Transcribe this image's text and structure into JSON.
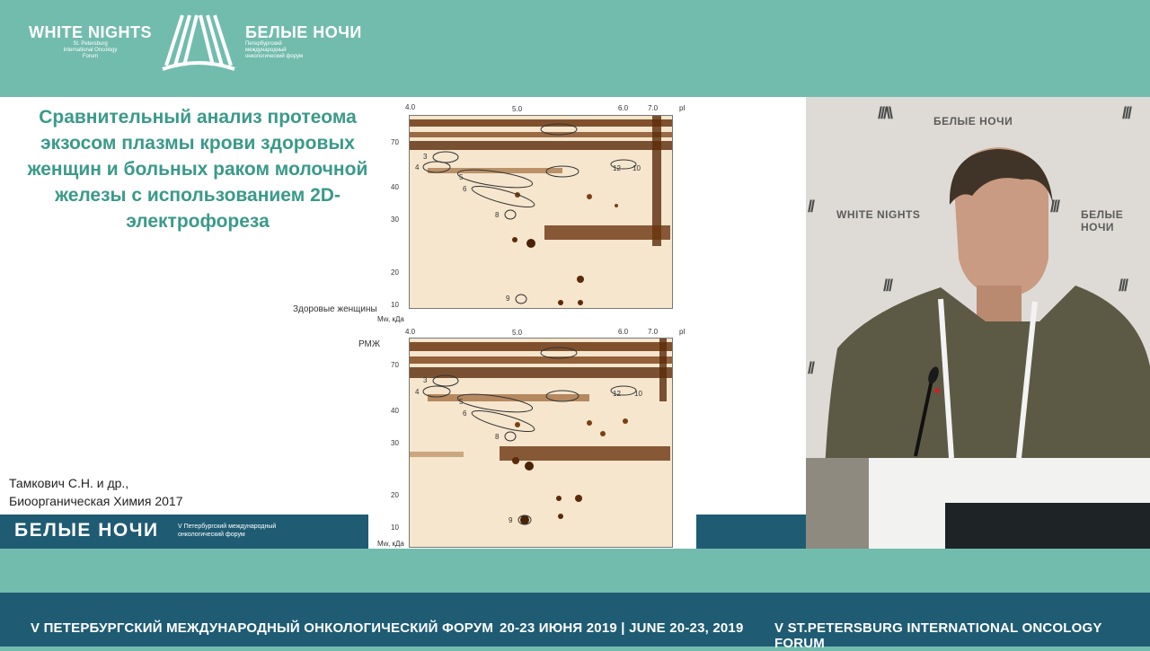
{
  "header": {
    "logo_en_title": "WHITE NIGHTS",
    "logo_en_sub": "St. Petersburg International Oncology Forum",
    "logo_ru_title": "БЕЛЫЕ НОЧИ",
    "logo_ru_sub": "Петербургский международный онкологический форум"
  },
  "slide": {
    "title": "Сравнительный анализ протеома экзосом плазмы крови здоровых женщин и больных раком молочной железы с использованием 2D-электрофореза",
    "citation_line1": "Тамкович С.Н. и др.,",
    "citation_line2": "Биоорганическая Химия 2017",
    "gels": [
      {
        "group_label": "Здоровые женщины",
        "ph_ticks": [
          "4.0",
          "5.0",
          "6.0",
          "7.0",
          "pI"
        ],
        "mw_ticks": [
          "70",
          "40",
          "30",
          "20",
          "10"
        ],
        "mw_unit": "Mw, кДа",
        "spot_labels": [
          "3",
          "4",
          "5",
          "6",
          "8",
          "9",
          "10",
          "12"
        ]
      },
      {
        "group_label": "РМЖ",
        "ph_ticks": [
          "4.0",
          "5.0",
          "6.0",
          "7.0",
          "pI"
        ],
        "mw_ticks": [
          "70",
          "40",
          "30",
          "20",
          "10"
        ],
        "mw_unit": "Mw, кДа",
        "spot_labels": [
          "3",
          "4",
          "5",
          "6",
          "8",
          "9",
          "10",
          "12"
        ]
      }
    ],
    "footer_name": "БЕЛЫЕ НОЧИ",
    "footer_sub": "V Петербургский международный онкологический форум"
  },
  "video": {
    "wm_ru": "БЕЛЫЕ НОЧИ",
    "wm_en": "WHITE NIGHTS"
  },
  "bottom_bar": {
    "left": "V ПЕТЕРБУРГСКИЙ МЕЖДУНАРОДНЫЙ ОНКОЛОГИЧЕСКИЙ ФОРУМ",
    "center": "20-23 ИЮНЯ 2019 | JUNE 20-23, 2019",
    "right": "V ST.PETERSBURG INTERNATIONAL ONCOLOGY FORUM"
  },
  "colors": {
    "teal_band": "#72bcae",
    "navy_bar": "#1f5c73",
    "title_teal": "#3a9a89",
    "gel_bg": "#f5e6cd",
    "gel_spot": "#6b3510"
  }
}
